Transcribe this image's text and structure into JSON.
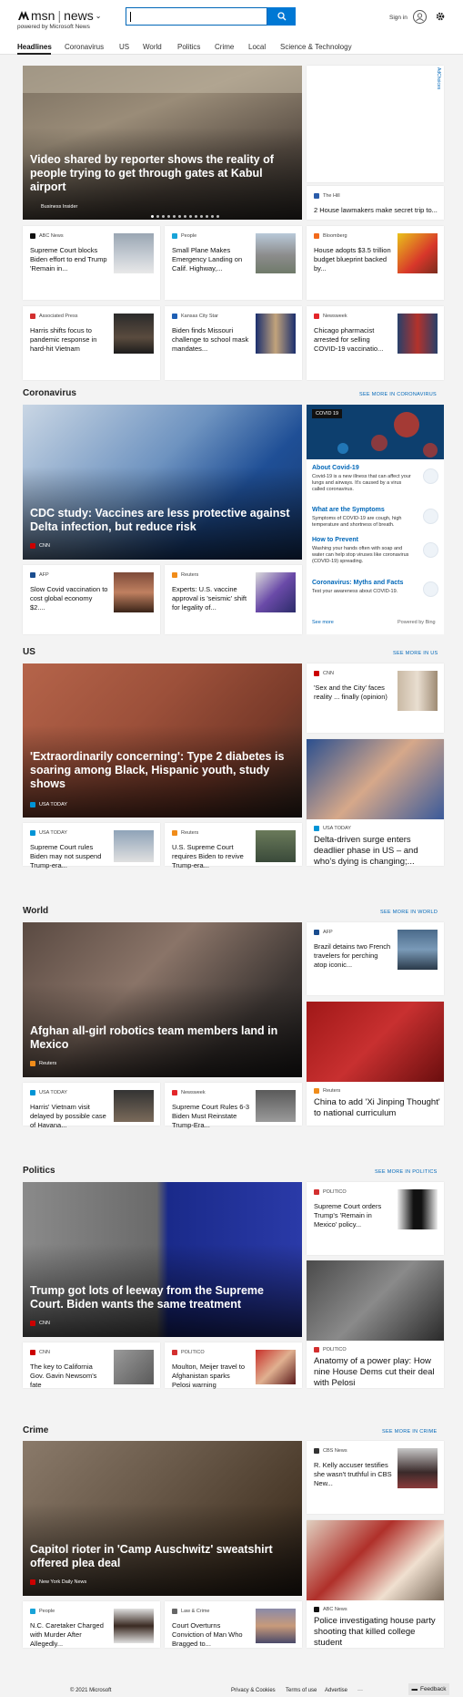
{
  "header": {
    "brand": "msn",
    "section": "news",
    "powered_by": "powered by Microsoft News",
    "signin": "Sign in"
  },
  "nav": [
    "Headlines",
    "Coronavirus",
    "US",
    "World",
    "Politics",
    "Crime",
    "Local",
    "Science & Technology"
  ],
  "ad_label": "AdChoices",
  "headlines": {
    "hero": {
      "title": "Video shared by reporter shows the reality of people trying to get through gates at Kabul airport",
      "source": "Business Insider"
    },
    "side": {
      "source": "The Hill",
      "title": "2 House lawmakers make secret trip to..."
    },
    "cards": [
      {
        "source": "ABC News",
        "title": "Supreme Court blocks Biden effort to end Trump 'Remain in..."
      },
      {
        "source": "People",
        "title": "Small Plane Makes Emergency Landing on Calif. Highway,..."
      },
      {
        "source": "Bloomberg",
        "title": "House adopts $3.5 trillion budget blueprint backed by..."
      },
      {
        "source": "Associated Press",
        "title": "Harris shifts focus to pandemic response in hard-hit Vietnam"
      },
      {
        "source": "Kansas City Star",
        "title": "Biden finds Missouri challenge to school mask mandates..."
      },
      {
        "source": "Newsweek",
        "title": "Chicago pharmacist arrested for selling COVID-19 vaccinatio..."
      }
    ]
  },
  "coronavirus": {
    "title": "Coronavirus",
    "see_more": "SEE MORE IN CORONAVIRUS",
    "hero": {
      "title": "CDC study: Vaccines are less protective against Delta infection, but reduce risk",
      "source": "CNN"
    },
    "cards": [
      {
        "source": "AFP",
        "title": "Slow Covid vaccination to cost global economy $2...."
      },
      {
        "source": "Reuters",
        "title": "Experts: U.S. vaccine approval is 'seismic' shift for legality of..."
      }
    ],
    "panel": {
      "tag": "COVID 19",
      "items": [
        {
          "q": "About Covid-19",
          "d": "Covid-19 is a new illness that can affect your lungs and airways. It's caused by a virus called coronavirus."
        },
        {
          "q": "What are the Symptoms",
          "d": "Symptoms of COVID-19 are cough, high temperature and shortness of breath."
        },
        {
          "q": "How to Prevent",
          "d": "Washing your hands often with soap and water can help stop viruses like coronavirus (COVID-19) spreading."
        },
        {
          "q": "Coronavirus: Myths and Facts",
          "d": "Test your awareness about COVID-19."
        }
      ],
      "see_more": "See more",
      "powered": "Powered by Bing"
    }
  },
  "us": {
    "title": "US",
    "see_more": "SEE MORE IN US",
    "hero": {
      "title": "'Extraordinarily concerning': Type 2 diabetes is soaring among Black, Hispanic youth, study shows",
      "source": "USA TODAY"
    },
    "side": {
      "source": "CNN",
      "title": "'Sex and the City' faces reality ... finally (opinion)"
    },
    "big": {
      "source": "USA TODAY",
      "title": "Delta-driven surge enters deadlier phase in US – and who's dying is changing;..."
    },
    "cards": [
      {
        "source": "USA TODAY",
        "title": "Supreme Court rules Biden may not suspend Trump-era..."
      },
      {
        "source": "Reuters",
        "title": "U.S. Supreme Court requires Biden to revive Trump-era..."
      }
    ]
  },
  "world": {
    "title": "World",
    "see_more": "SEE MORE IN WORLD",
    "hero": {
      "title": "Afghan all-girl robotics team members land in Mexico",
      "source": "Reuters"
    },
    "side": {
      "source": "AFP",
      "title": "Brazil detains two French travelers for perching atop iconic..."
    },
    "big": {
      "source": "Reuters",
      "title": "China to add 'Xi Jinping Thought' to national curriculum"
    },
    "cards": [
      {
        "source": "USA TODAY",
        "title": "Harris' Vietnam visit delayed by possible case of Havana..."
      },
      {
        "source": "Newsweek",
        "title": "Supreme Court Rules 6-3 Biden Must Reinstate Trump-Era..."
      }
    ]
  },
  "politics": {
    "title": "Politics",
    "see_more": "SEE MORE IN POLITICS",
    "hero": {
      "title": "Trump got lots of leeway from the Supreme Court. Biden wants the same treatment",
      "source": "CNN"
    },
    "side": {
      "source": "POLITICO",
      "title": "Supreme Court orders Trump's 'Remain in Mexico' policy..."
    },
    "big": {
      "source": "POLITICO",
      "title": "Anatomy of a power play: How nine House Dems cut their deal with Pelosi"
    },
    "cards": [
      {
        "source": "CNN",
        "title": "The key to California Gov. Gavin Newsom's fate"
      },
      {
        "source": "POLITICO",
        "title": "Moulton, Meijer travel to Afghanistan sparks Pelosi warning"
      }
    ]
  },
  "crime": {
    "title": "Crime",
    "see_more": "SEE MORE IN CRIME",
    "hero": {
      "title": "Capitol rioter in 'Camp Auschwitz' sweatshirt offered plea deal",
      "source": "New York Daily News"
    },
    "side": {
      "source": "CBS News",
      "title": "R. Kelly accuser testifies she wasn't truthful in CBS New..."
    },
    "big": {
      "source": "ABC News",
      "title": "Police investigating house party shooting that killed college student"
    },
    "cards": [
      {
        "source": "People",
        "title": "N.C. Caretaker Charged with Murder After Allegedly..."
      },
      {
        "source": "Law & Crime",
        "title": "Court Overturns Conviction of Man Who Bragged to..."
      }
    ]
  },
  "footer": {
    "copyright": "© 2021 Microsoft",
    "links": [
      "Privacy & Cookies",
      "Terms of use",
      "Advertise"
    ],
    "more": "···",
    "feedback": "Feedback"
  },
  "colors": {
    "accent": "#0078d4",
    "link": "#0067b8"
  },
  "icons": [
    "search-icon",
    "user-icon",
    "gear-icon"
  ]
}
